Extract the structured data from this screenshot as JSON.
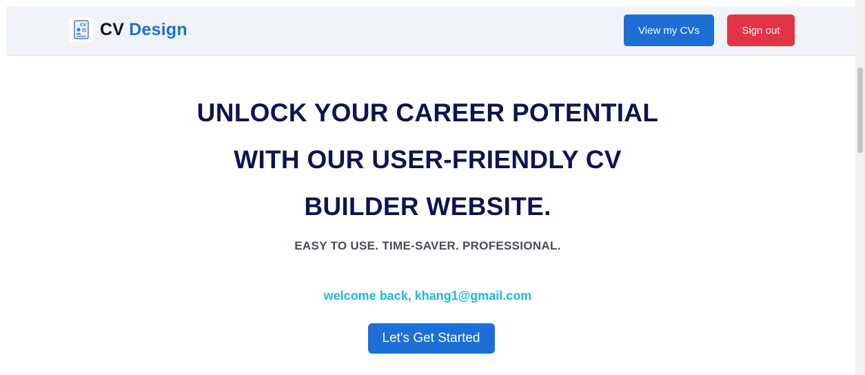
{
  "navbar": {
    "brand": {
      "logo_icon": "cv-document-icon",
      "part1": "CV",
      "part2": "Design"
    },
    "view_cvs_label": "View my CVs",
    "sign_out_label": "Sign out"
  },
  "hero": {
    "title_line1": "UNLOCK YOUR CAREER POTENTIAL",
    "title_line2": "WITH OUR USER-FRIENDLY CV",
    "title_line3": "BUILDER WEBSITE.",
    "tagline": "EASY TO USE. TIME-SAVER. PROFESSIONAL.",
    "welcome": "welcome back, khang1@gmail.com",
    "cta_label": "Let's Get Started"
  },
  "colors": {
    "primary": "#1d6fd6",
    "danger": "#e23444",
    "heading": "#0f1350",
    "welcome": "#22b7d9",
    "navbar_bg": "#f0f4f9"
  }
}
